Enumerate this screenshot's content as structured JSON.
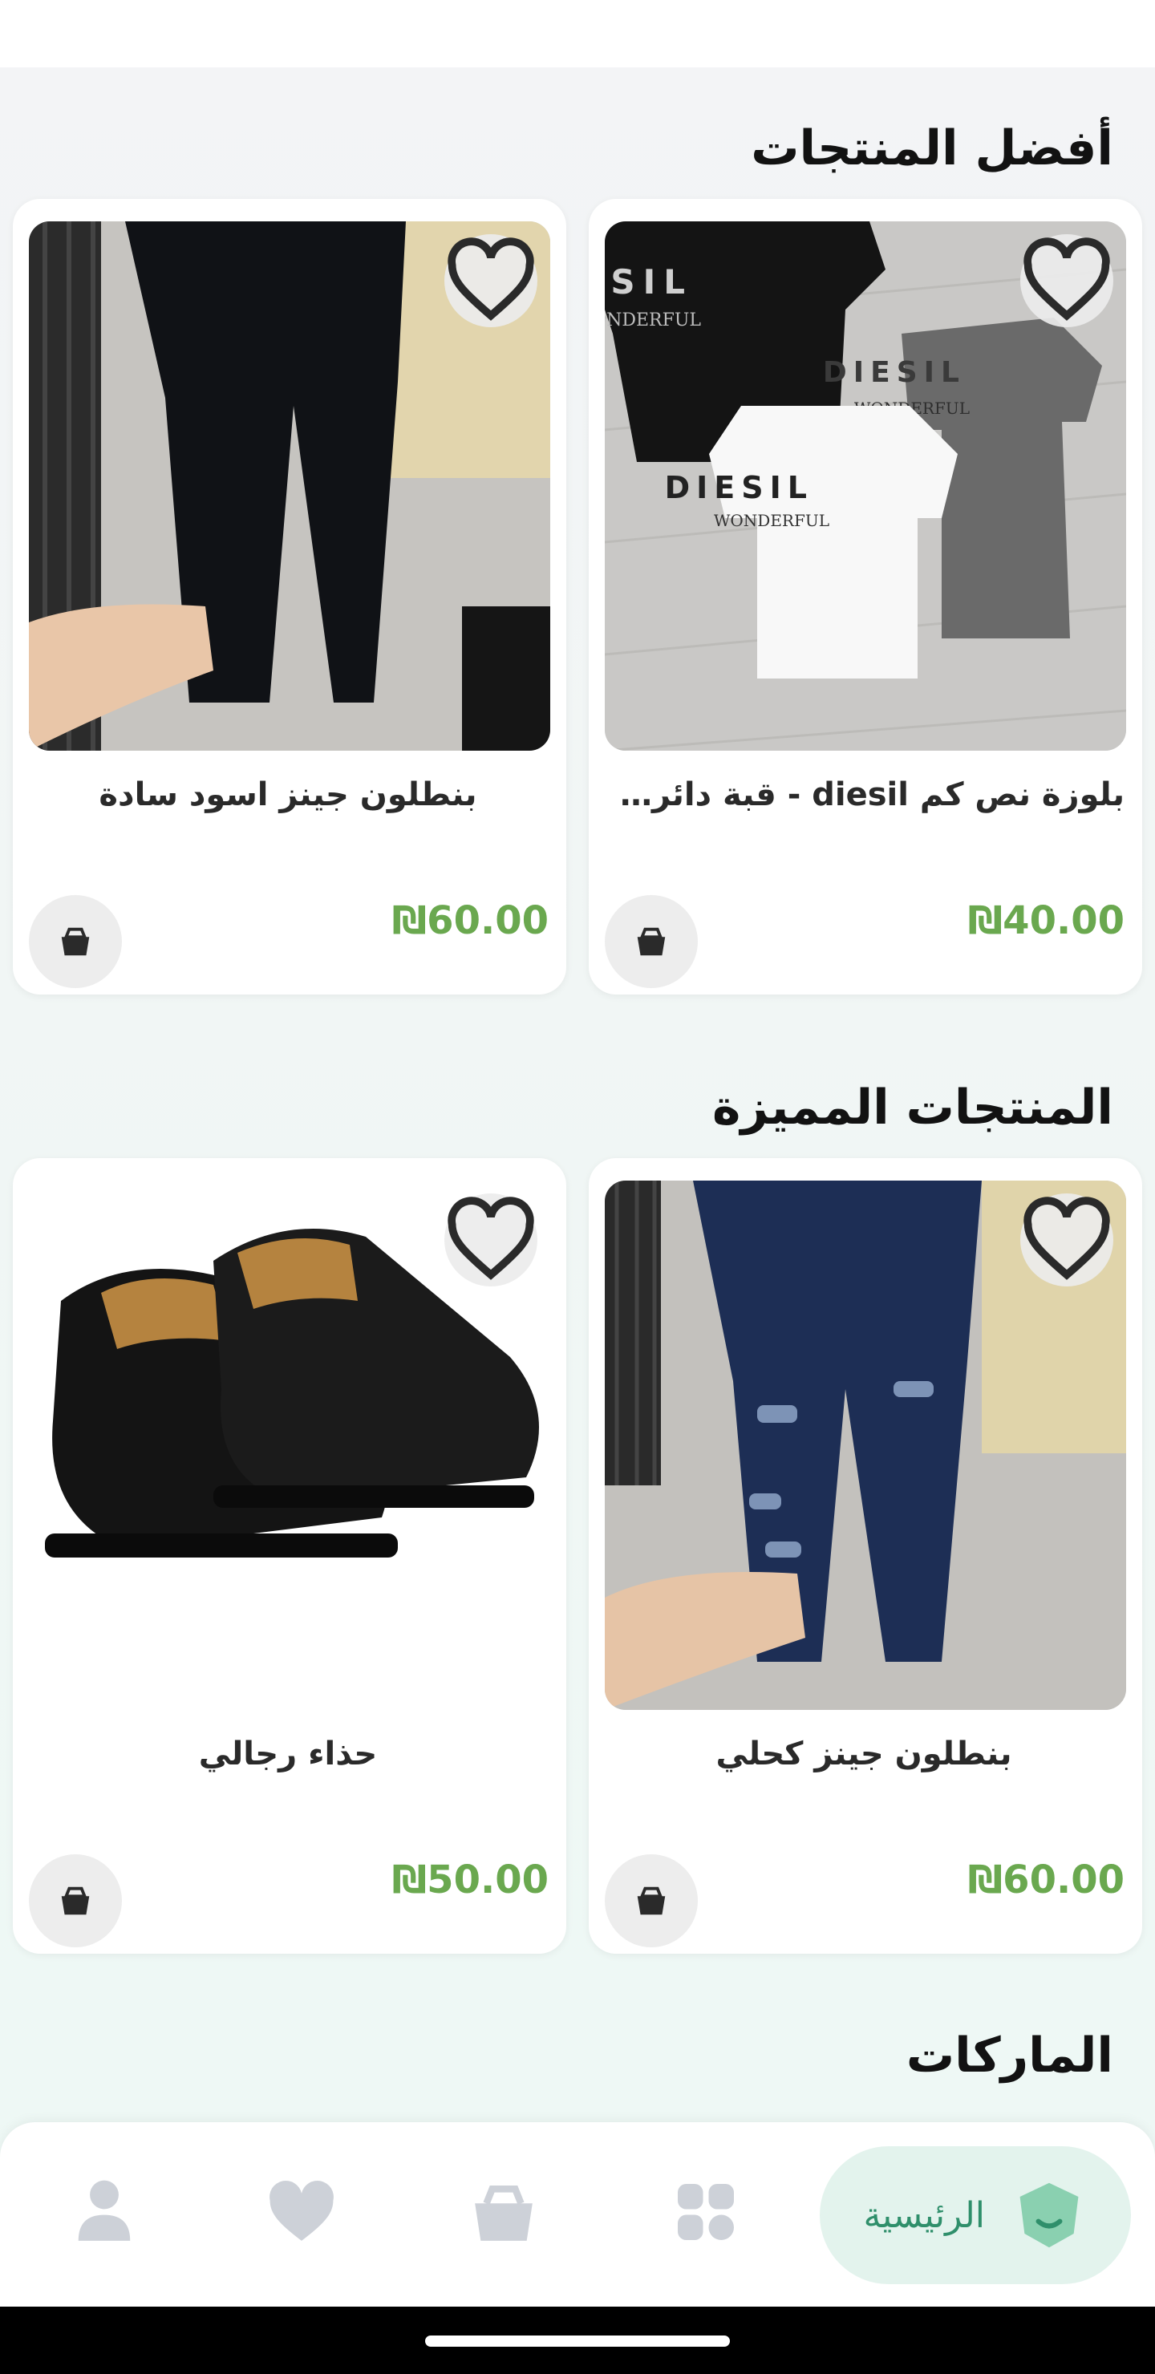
{
  "sections": {
    "best": "أفضل المنتجات",
    "featured": "المنتجات المميزة",
    "brands": "الماركات"
  },
  "products": [
    {
      "name": "بلوزة نص كم  diesil - قبة دائري...",
      "price": "₪40.00",
      "image": "t-shirts-diesel"
    },
    {
      "name": "بنطلون جينز اسود سادة",
      "price": "₪60.00",
      "image": "black-jeans"
    },
    {
      "name": "بنطلون جينز كحلي",
      "price": "₪60.00",
      "image": "navy-ripped-jeans"
    },
    {
      "name": "حذاء رجالي",
      "price": "₪50.00",
      "image": "black-leather-shoes"
    }
  ],
  "nav": {
    "home_label": "الرئيسية",
    "items": [
      "home-icon",
      "categories-icon",
      "cart-icon",
      "heart-icon",
      "profile-icon"
    ],
    "active_color": "#2f8f6b",
    "active_bg": "#e3f3ed",
    "inactive_color": "#cdd1d8"
  },
  "colors": {
    "price": "#6aa84f",
    "accent": "#8ad0b0"
  }
}
